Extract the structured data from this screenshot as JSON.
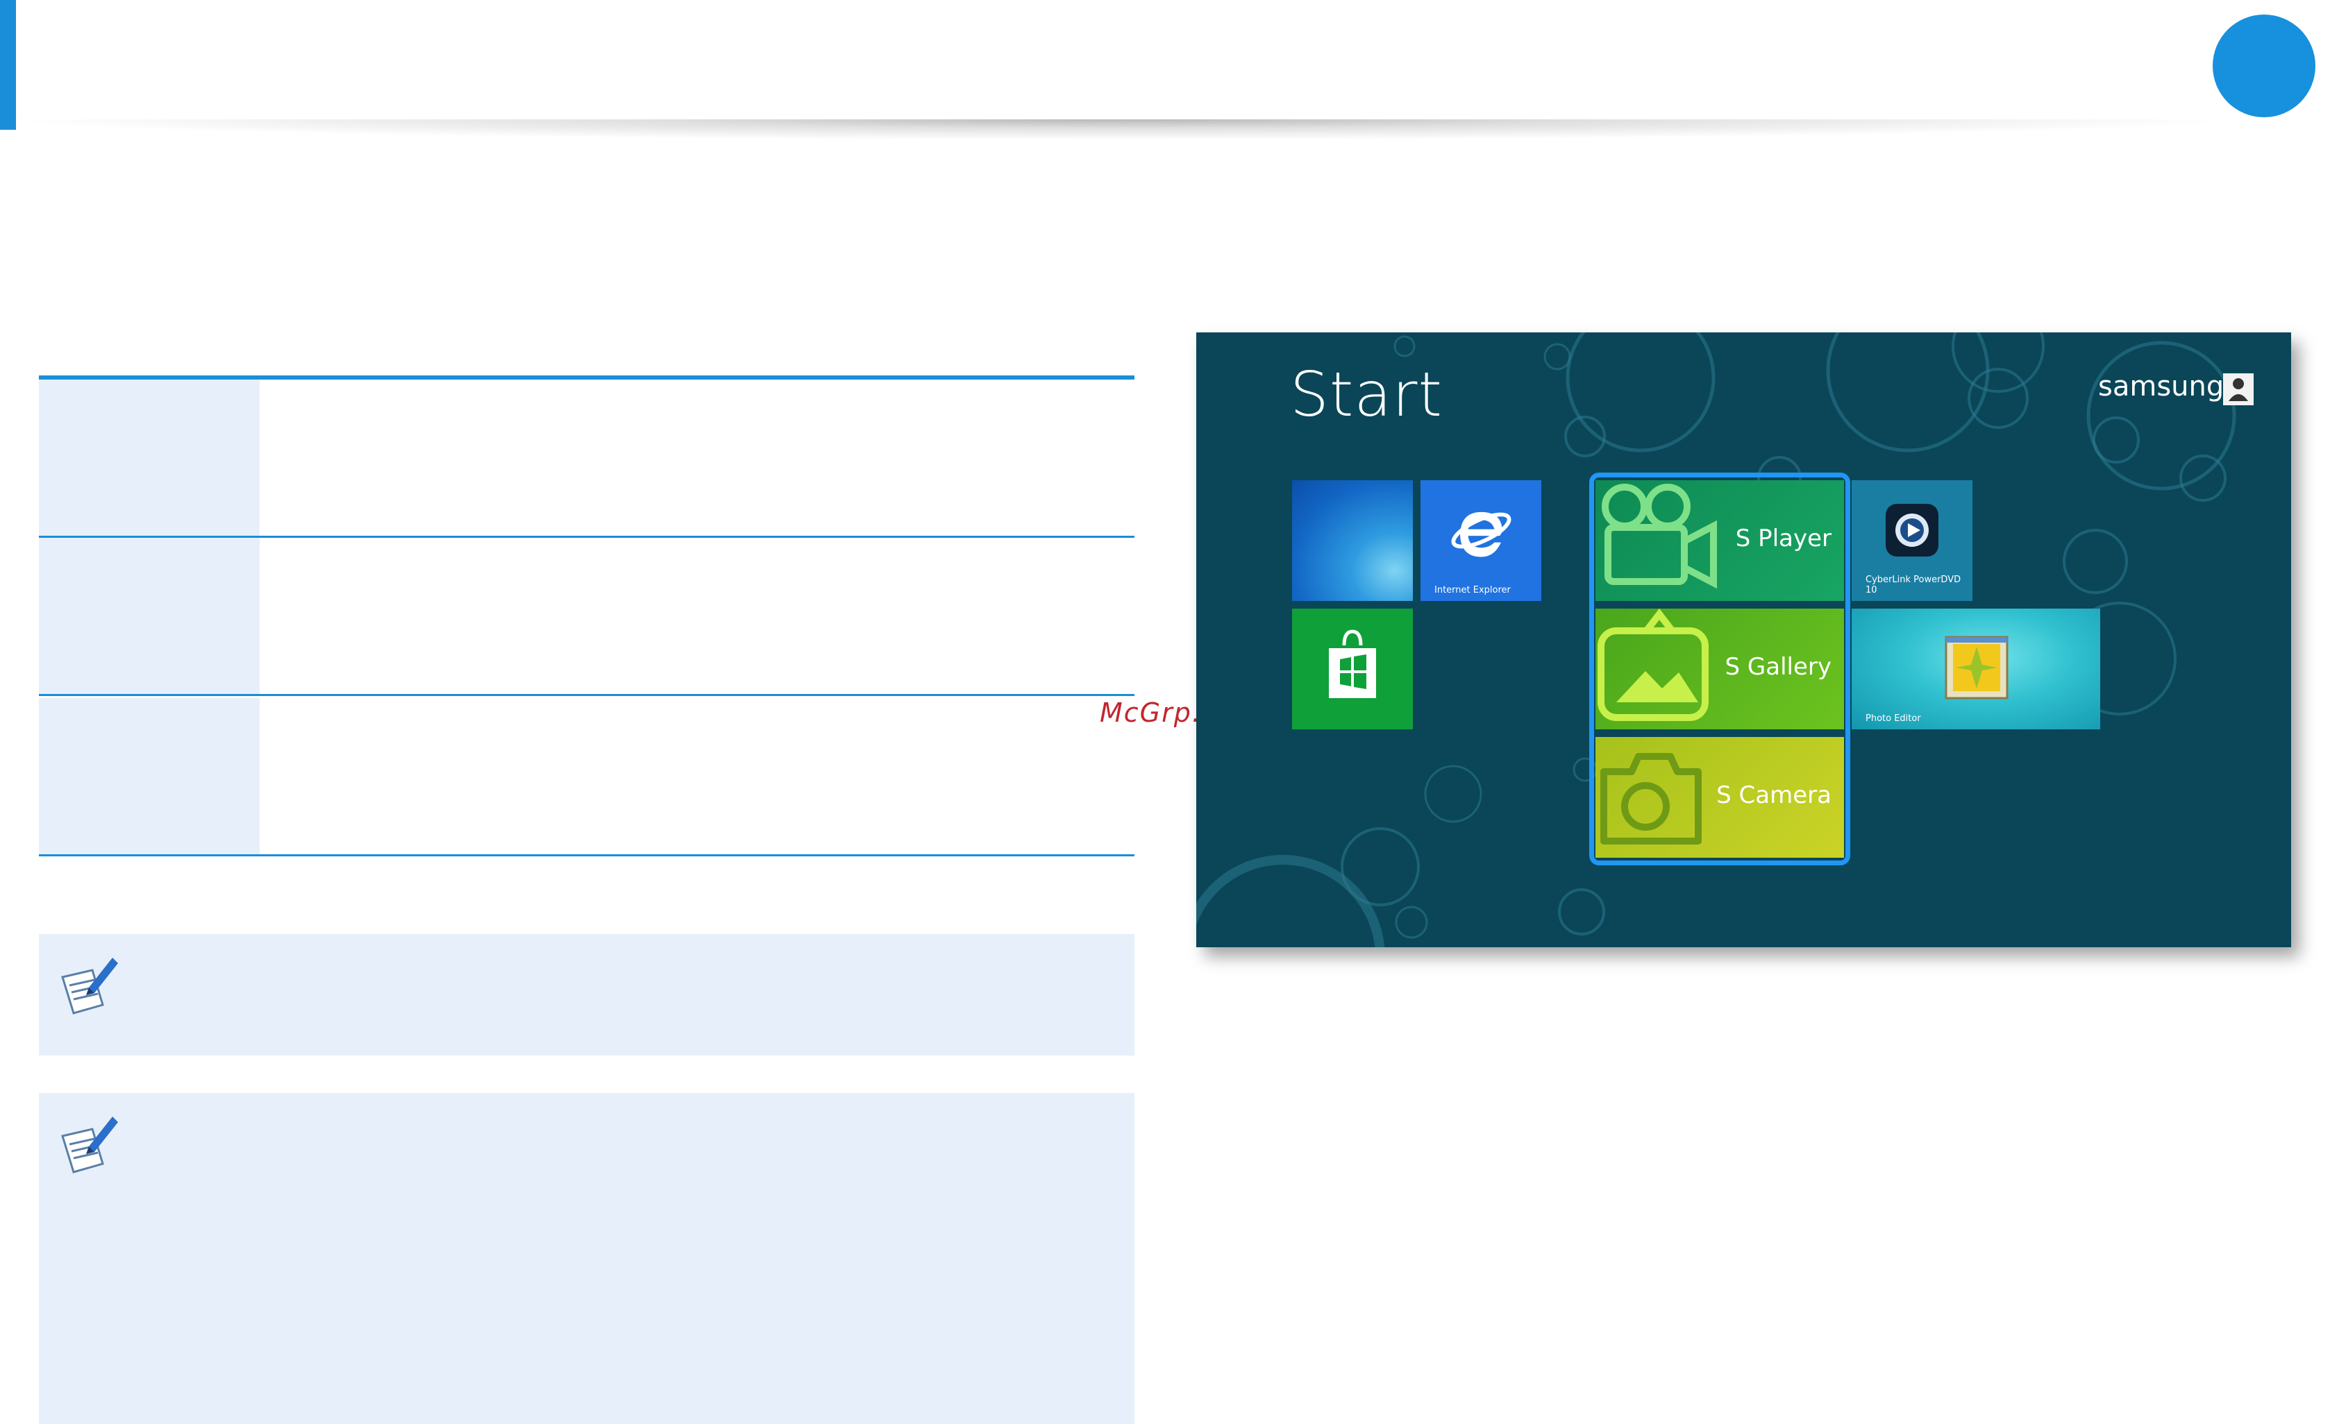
{
  "header": {
    "page_number": ""
  },
  "table": {
    "rows": [
      {
        "label": "",
        "value": ""
      },
      {
        "label": "",
        "value": ""
      },
      {
        "label": "",
        "value": ""
      }
    ]
  },
  "notes": [
    {
      "icon": "note-pencil-icon",
      "text": ""
    },
    {
      "icon": "note-pencil-icon",
      "text": ""
    }
  ],
  "watermark": "McGrp.Ru",
  "start_screen": {
    "title": "Start",
    "user": "samsung",
    "tiles": {
      "desktop": {
        "label": ""
      },
      "ie": {
        "label": "Internet Explorer"
      },
      "store": {
        "label": ""
      },
      "s_player": {
        "label": "S Player"
      },
      "s_gallery": {
        "label": "S Gallery"
      },
      "s_camera": {
        "label": "S Camera"
      },
      "powerdvd": {
        "label": "CyberLink PowerDVD 10"
      },
      "photo_editor": {
        "label": "Photo Editor"
      }
    },
    "colors": {
      "background": "#0a4658",
      "highlight": "#2196f3"
    }
  }
}
